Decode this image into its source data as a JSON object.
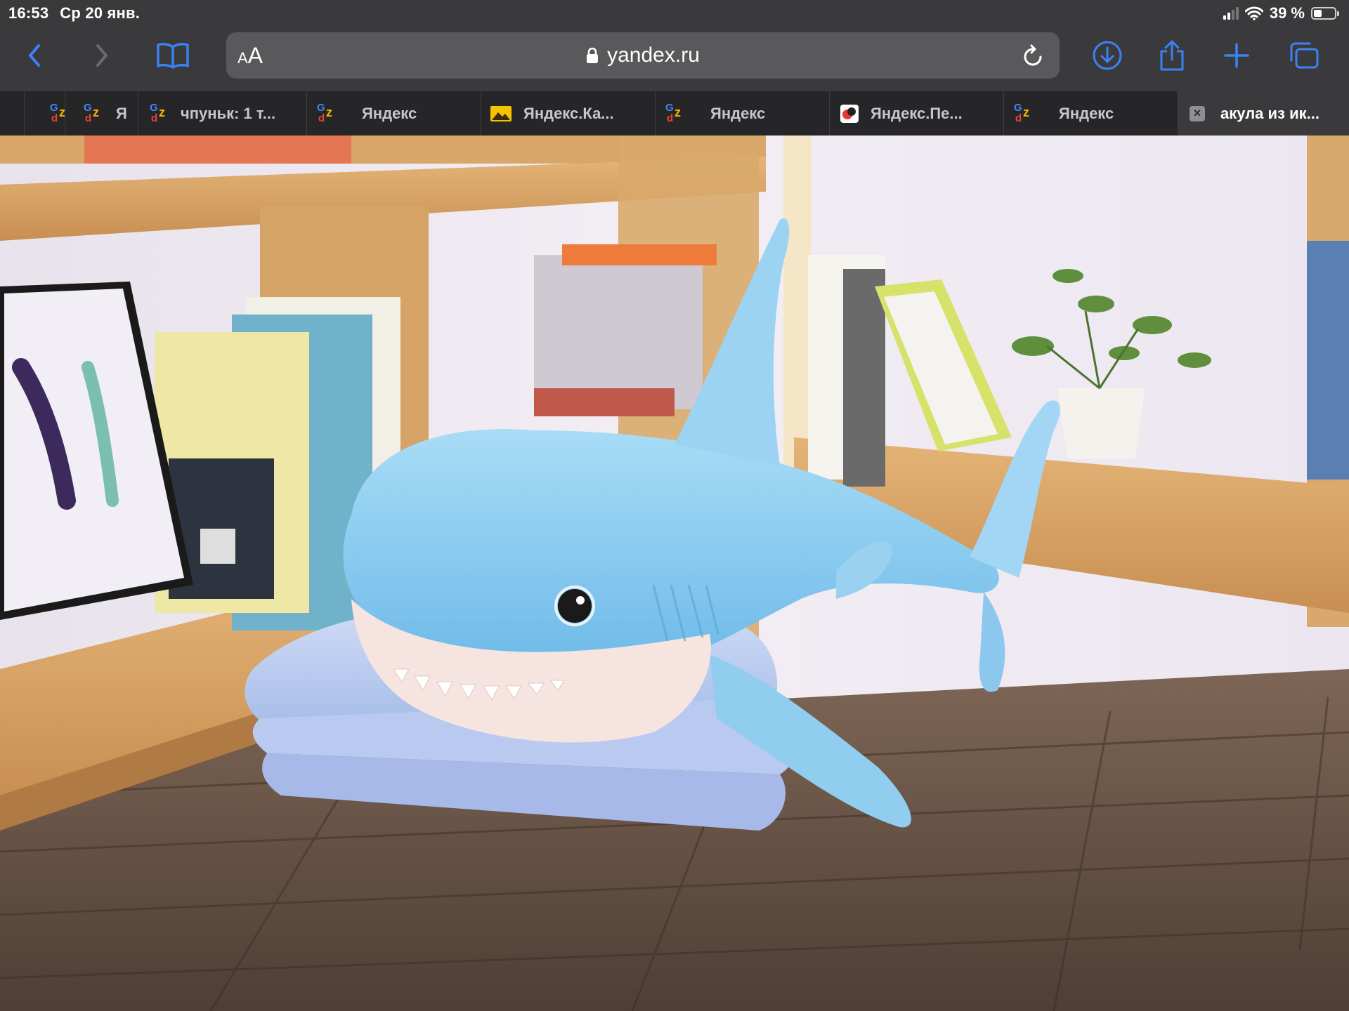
{
  "status_bar": {
    "time": "16:53",
    "date": "Ср 20 янв.",
    "battery_text": "39 %",
    "battery_level": 0.39
  },
  "toolbar": {
    "reader_small": "A",
    "reader_large": "A",
    "url": "yandex.ru",
    "accent_color": "#3b82f6",
    "icons": [
      "back-icon",
      "forward-icon",
      "bookmarks-icon",
      "lock-icon",
      "reload-icon",
      "download-icon",
      "share-icon",
      "new-tab-icon",
      "tabs-overview-icon"
    ]
  },
  "tabs": [
    {
      "label": "",
      "favicon": "gz-favicon"
    },
    {
      "label": "Я",
      "favicon": "gz-favicon"
    },
    {
      "label": "чпуньк: 1 т...",
      "favicon": "gz-favicon"
    },
    {
      "label": "Яндекс",
      "favicon": "gz-favicon"
    },
    {
      "label": "Яндекс.Ка...",
      "favicon": "yandex-images-favicon"
    },
    {
      "label": "Яндекс",
      "favicon": "gz-favicon"
    },
    {
      "label": "Яндекс.Пе...",
      "favicon": "yandex-translate-favicon"
    },
    {
      "label": "Яндекс",
      "favicon": "gz-favicon"
    },
    {
      "label": "акула из ик...",
      "favicon": "close-icon",
      "active": true
    }
  ]
}
